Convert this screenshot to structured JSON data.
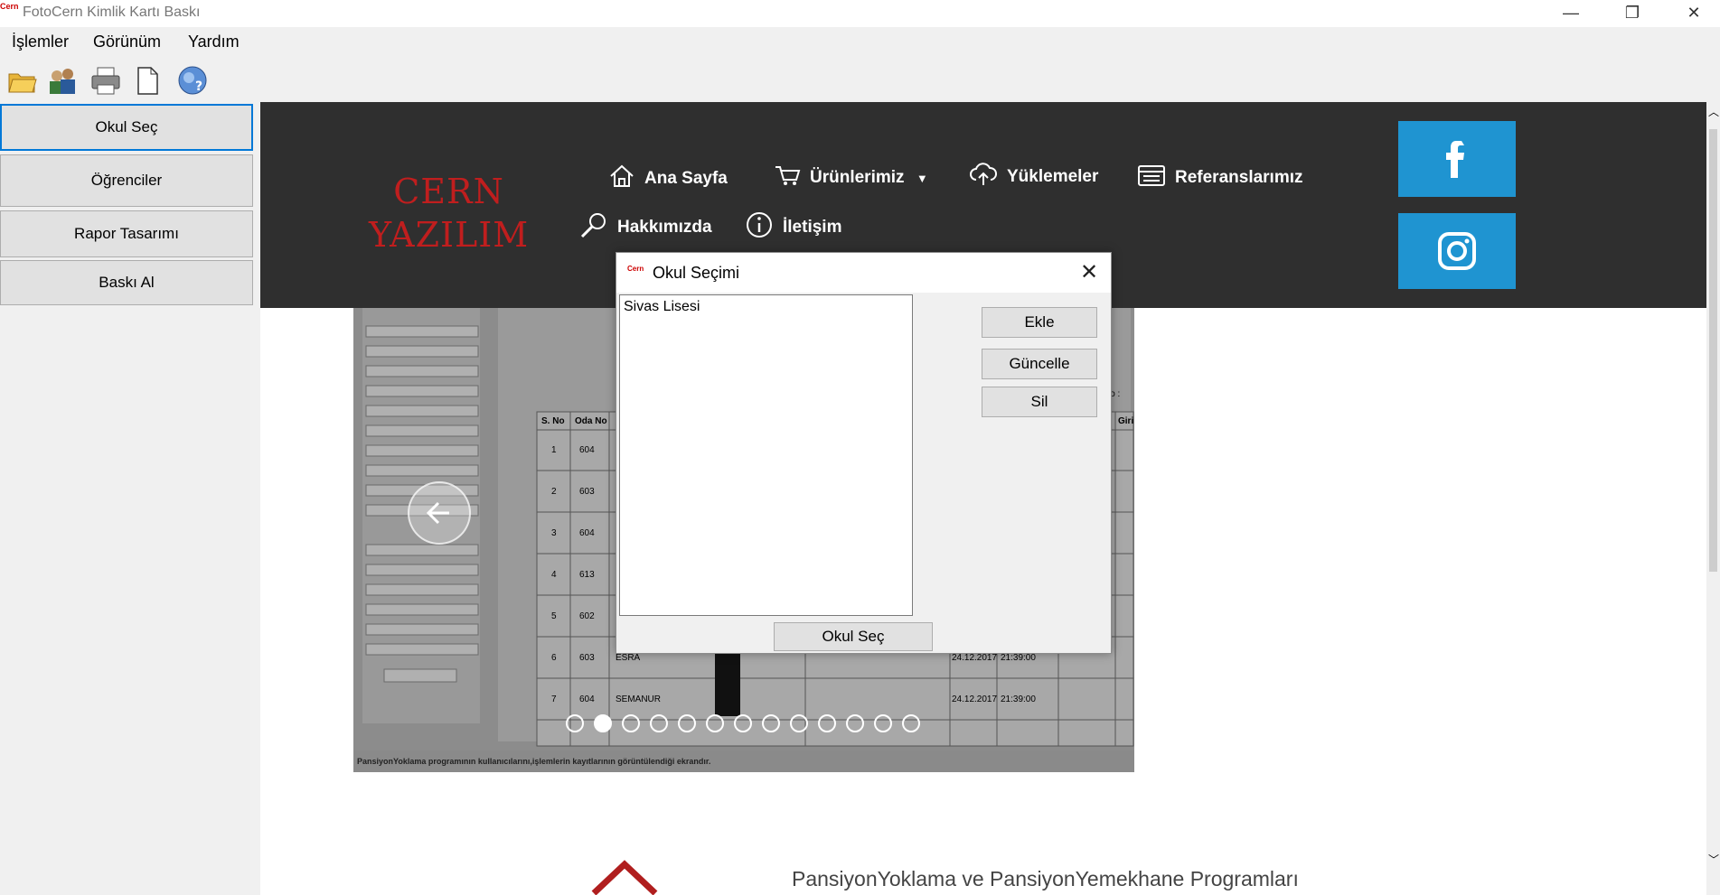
{
  "window": {
    "app_icon_text": "Cern",
    "title": "FotoCern Kimlik Kartı Baskı",
    "minimize": "—",
    "restore": "❐",
    "close": "✕"
  },
  "menu": {
    "items": [
      "İşlemler",
      "Görünüm",
      "Yardım"
    ]
  },
  "toolbar": {
    "icons": [
      "open-folder-icon",
      "users-icon",
      "print-icon",
      "new-page-icon",
      "help-icon"
    ]
  },
  "sidebar": {
    "items": [
      "Okul Seç",
      "Öğrenciler",
      "Rapor Tasarımı",
      "Baskı Al"
    ]
  },
  "site": {
    "logo_line1": "CERN",
    "logo_line2": "YAZILIM",
    "nav": {
      "home": "Ana Sayfa",
      "products": "Ürünlerimiz",
      "downloads": "Yüklemeler",
      "references": "Referanslarımız",
      "about": "Hakkımızda",
      "contact": "İletişim"
    },
    "social": [
      "facebook-icon",
      "instagram-icon"
    ],
    "promo_text": "PansiyonYoklama ve PansiyonYemekhane Programları",
    "slider_dot_count": 13,
    "slider_active_dot": 1
  },
  "slide": {
    "table_headers": [
      "S. No",
      "Oda No"
    ],
    "partial_headers": [
      "No :",
      "Giri"
    ],
    "rows": [
      {
        "no": "1",
        "room": "604"
      },
      {
        "no": "2",
        "room": "603"
      },
      {
        "no": "3",
        "room": "604"
      },
      {
        "no": "4",
        "room": "613"
      },
      {
        "no": "5",
        "room": "602"
      },
      {
        "no": "6",
        "room": "603",
        "name": "ESRA",
        "date": "24.12.2017",
        "time": "21:39:00"
      },
      {
        "no": "7",
        "room": "604",
        "name": "SEMANUR",
        "date": "24.12.2017",
        "time": "21:39:00"
      }
    ],
    "caption": "PansiyonYoklama programının kullanıcılarını,işlemlerin kayıtlarının görüntülendiği ekrandır."
  },
  "dialog": {
    "icon_text": "Cern",
    "title": "Okul Seçimi",
    "close": "✕",
    "list": [
      "Sivas Lisesi"
    ],
    "buttons": {
      "add": "Ekle",
      "update": "Güncelle",
      "delete": "Sil",
      "select": "Okul Seç"
    }
  },
  "colors": {
    "header_bg": "#2f2f2f",
    "logo_red": "#c01e1e",
    "social_blue": "#1f94d1",
    "active_border": "#0078d7"
  }
}
